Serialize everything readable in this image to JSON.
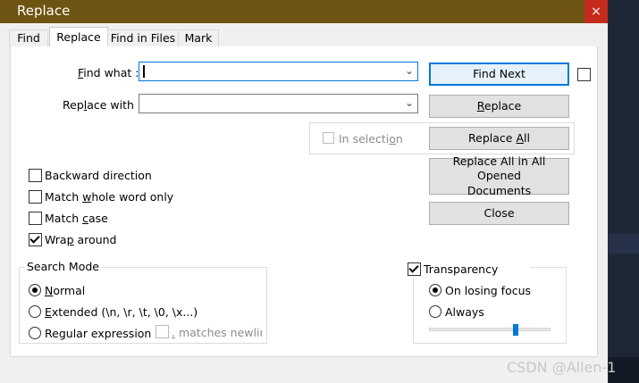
{
  "window": {
    "title": "Replace",
    "close_glyph": "×"
  },
  "tabs": [
    {
      "label": "Find",
      "active": false
    },
    {
      "label": "Replace",
      "active": true
    },
    {
      "label": "Find in Files",
      "active": false
    },
    {
      "label": "Mark",
      "active": false
    }
  ],
  "find_what": {
    "label_pre": "",
    "label_ul": "F",
    "label_post": "ind what :",
    "value": ""
  },
  "replace_with": {
    "label_pre": "Rep",
    "label_ul": "l",
    "label_post": "ace with :",
    "value": ""
  },
  "buttons": {
    "find_next": "Find Next",
    "replace_pre": "",
    "replace_ul": "R",
    "replace_post": "eplace",
    "replace_all_pre": "Replace ",
    "replace_all_ul": "A",
    "replace_all_post": "ll",
    "replace_all_opened_line1": "Replace All in All Opened",
    "replace_all_opened_line2": "Documents",
    "close": "Close"
  },
  "in_selection": {
    "label_pre": "In selecti",
    "label_ul": "o",
    "label_post": "n",
    "checked": false,
    "enabled": false
  },
  "options": {
    "backward_direction": {
      "pre": "Backward direction",
      "ul": "",
      "post": "",
      "checked": false
    },
    "match_whole_word": {
      "pre": "Match ",
      "ul": "w",
      "post": "hole word only",
      "checked": false
    },
    "match_case": {
      "pre": "Match ",
      "ul": "c",
      "post": "ase",
      "checked": false
    },
    "wrap_around": {
      "pre": "Wra",
      "ul": "p",
      "post": " around",
      "checked": true
    }
  },
  "search_mode": {
    "title": "Search Mode",
    "normal": {
      "pre": "",
      "ul": "N",
      "post": "ormal",
      "selected": true
    },
    "extended": {
      "pre": "",
      "ul": "E",
      "post": "xtended (\\n, \\r, \\t, \\0, \\x...)",
      "selected": false
    },
    "regex": {
      "pre": "Re",
      "ul": "g",
      "post": "ular expression",
      "selected": false
    },
    "matches_newline": {
      "pre": "",
      "ul": ".",
      "post": " matches newline",
      "checked": false,
      "enabled": false
    }
  },
  "transparency": {
    "label": "Transparency",
    "checked": true,
    "on_losing_focus": {
      "label": "On losing focus",
      "selected": true
    },
    "always": {
      "label": "Always",
      "selected": false
    },
    "level": 0.72
  },
  "watermark": "CSDN @Allen-1"
}
